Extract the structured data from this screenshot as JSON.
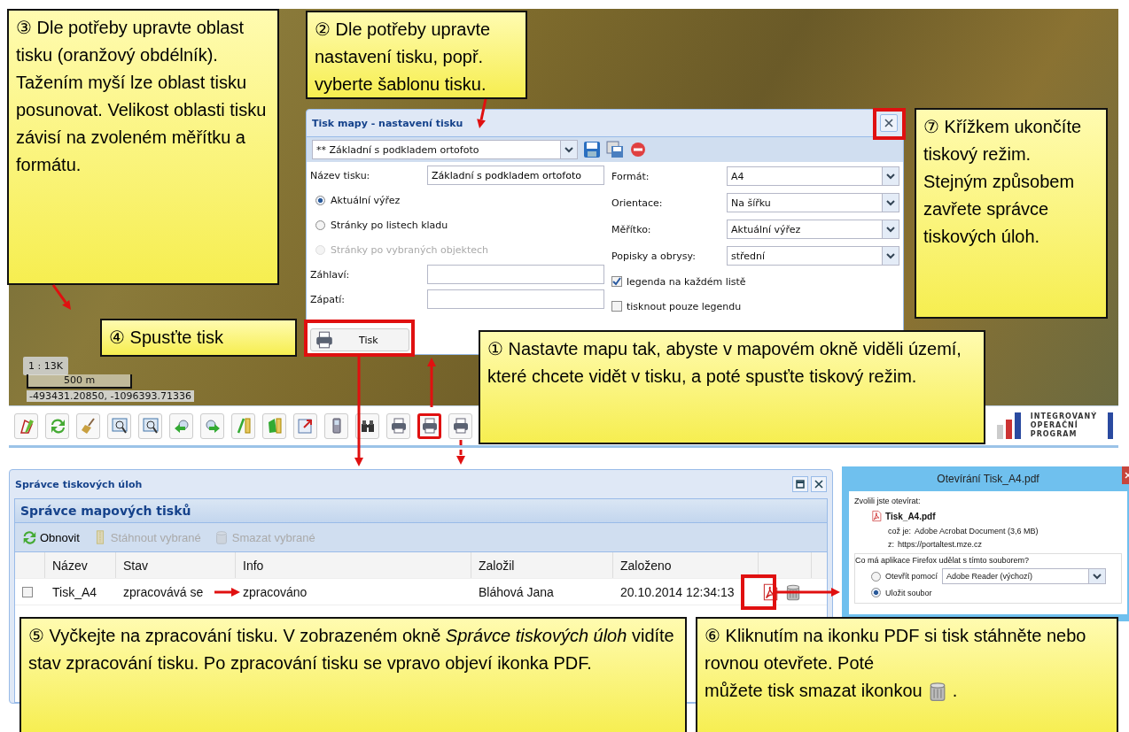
{
  "map": {
    "scale": "1 : 13K",
    "scalebar": "500 m",
    "coordinates": "-493431.20850, -1096393.71336"
  },
  "toolbar": {
    "buttons": [
      {
        "kind": "draw",
        "highlighted": false
      },
      {
        "kind": "refresh",
        "highlighted": false
      },
      {
        "kind": "broom",
        "highlighted": false
      },
      {
        "kind": "zoom",
        "highlighted": false
      },
      {
        "kind": "zoom",
        "highlighted": false
      },
      {
        "kind": "back",
        "highlighted": false
      },
      {
        "kind": "forward",
        "highlighted": false
      },
      {
        "kind": "ruler",
        "highlighted": false
      },
      {
        "kind": "area",
        "highlighted": false
      },
      {
        "kind": "export",
        "highlighted": false
      },
      {
        "kind": "phone",
        "highlighted": false
      },
      {
        "kind": "binoculars",
        "highlighted": false
      },
      {
        "kind": "print",
        "highlighted": false
      },
      {
        "kind": "print",
        "highlighted": true
      },
      {
        "kind": "print",
        "highlighted": false
      }
    ]
  },
  "logo": {
    "lines": [
      "INTEGROVANÝ",
      "OPERAČNÍ",
      "PROGRAM"
    ]
  },
  "print_dialog": {
    "title": "Tisk mapy - nastavení tisku",
    "close_highlighted": true,
    "template": "** Základní s podkladem ortofoto",
    "name_label": "Název tisku:",
    "name_value": "Základní s podkladem ortofoto",
    "radios": [
      {
        "label": "Aktuální výřez",
        "selected": true,
        "disabled": false
      },
      {
        "label": "Stránky po listech kladu",
        "selected": false,
        "disabled": false
      },
      {
        "label": "Stránky po vybraných objektech",
        "selected": false,
        "disabled": true
      }
    ],
    "header_label": "Záhlaví:",
    "footer_label": "Zápatí:",
    "selects": [
      {
        "label": "Formát:",
        "value": "A4"
      },
      {
        "label": "Orientace:",
        "value": "Na šířku"
      },
      {
        "label": "Měřítko:",
        "value": "Aktuální výřez"
      },
      {
        "label": "Popisky a obrysy:",
        "value": "střední"
      }
    ],
    "checkboxes": [
      {
        "label": "legenda na každém listě",
        "checked": true
      },
      {
        "label": "tisknout pouze legendu",
        "checked": false
      }
    ],
    "print_button": {
      "label": "Tisk",
      "highlighted": true
    }
  },
  "task_manager": {
    "title": "Správce tiskových úloh",
    "panel_title": "Správce mapových tisků",
    "actions": [
      {
        "label": "Obnovit",
        "kind": "refresh",
        "disabled": false
      },
      {
        "label": "Stáhnout vybrané",
        "kind": "download",
        "disabled": true
      },
      {
        "label": "Smazat vybrané",
        "kind": "delete",
        "disabled": true
      }
    ],
    "columns": [
      "Název",
      "Stav",
      "Info",
      "Založil",
      "Založeno"
    ],
    "rows": [
      {
        "checked": false,
        "cells": [
          "Tisk_A4",
          "zpracovává se",
          "zpracováno",
          "Bláhová Jana",
          "20.10.2014 12:34:13"
        ],
        "pdf_highlighted": true
      }
    ]
  },
  "download_dialog": {
    "title": "Otevírání Tisk_A4.pdf",
    "intro": "Zvolili jste otevírat:",
    "file": "Tisk_A4.pdf",
    "type_label": "což je:",
    "type_value": "Adobe Acrobat Document (3,6 MB)",
    "from_label": "z:",
    "from_value": "https://portaltest.mze.cz",
    "question": "Co má aplikace Firefox udělat s tímto souborem?",
    "app": "Adobe Reader  (výchozí)",
    "options": [
      {
        "label": "Otevřít pomocí",
        "selected": false
      },
      {
        "label": "Uložit soubor",
        "selected": true
      }
    ]
  },
  "callouts": [
    {
      "text": "③ Dle potřeby upravte oblast tisku (oranžový obdélník). Tažením myší lze oblast tisku posunovat. Velikost oblasti tisku závisí na zvoleném měřítku a formátu."
    },
    {
      "text": "② Dle potřeby upravte nastavení tisku, popř. vyberte šablonu tisku."
    },
    {
      "text": "⑦ Křížkem ukončíte tiskový režim. Stejným způsobem zavřete správce tiskových úloh."
    },
    {
      "text": "④ Spusťte tisk"
    },
    {
      "text": "① Nastavte mapu tak, abyste v mapovém okně viděli území, které chcete vidět v tisku, a poté spusťte tiskový režim."
    },
    {
      "text": "⑤ Vyčkejte na zpracování tisku. V zobrazeném okně *Správce tiskových úloh* vidíte stav zpracování tisku. Po zpracování tisku se vpravo objeví ikonka PDF."
    },
    {
      "kind": "icon_end",
      "text": "⑥ Kliknutím na ikonku PDF si tisk stáhněte nebo rovnou otevřete. Poté",
      "last_line": "můžete tisk smazat ikonkou",
      "after": "."
    }
  ]
}
